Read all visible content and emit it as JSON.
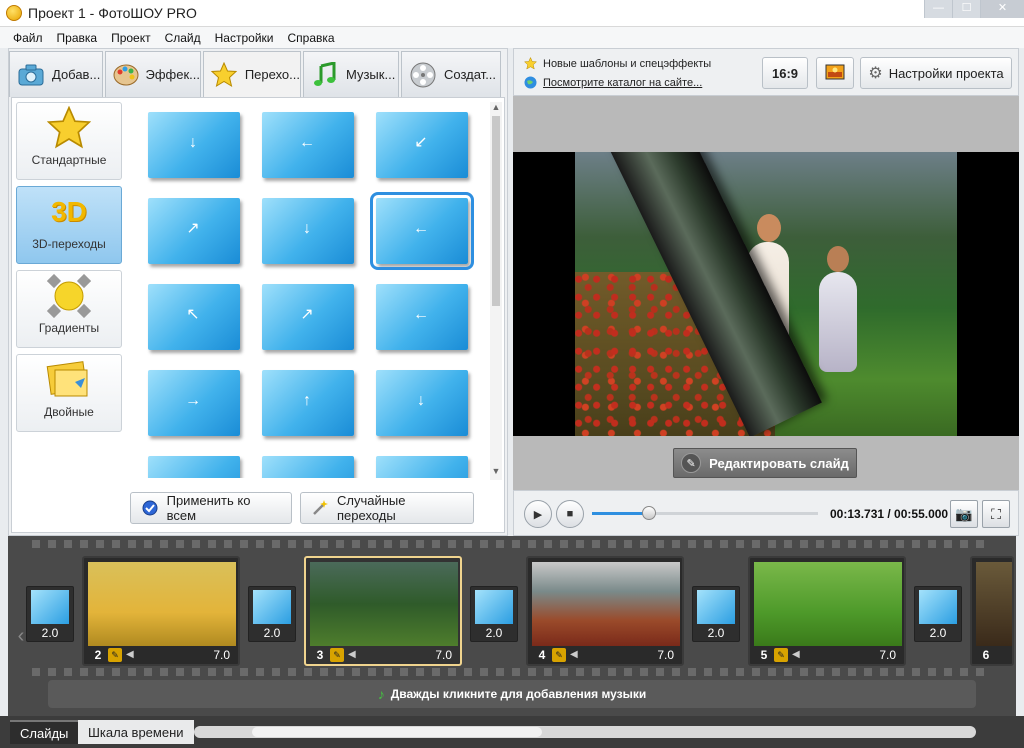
{
  "window": {
    "title": "Проект 1 - ФотоШОУ PRO",
    "min_btn": "—",
    "max_btn": "☐",
    "close_btn": "✕"
  },
  "menu": [
    "Файл",
    "Правка",
    "Проект",
    "Слайд",
    "Настройки",
    "Справка"
  ],
  "tabs": [
    {
      "label": "Добав...",
      "icon": "camera-icon"
    },
    {
      "label": "Эффек...",
      "icon": "palette-icon"
    },
    {
      "label": "Перехо...",
      "icon": "star-icon",
      "active": true
    },
    {
      "label": "Музык...",
      "icon": "music-note-icon"
    },
    {
      "label": "Создат...",
      "icon": "film-reel-icon"
    }
  ],
  "categories": [
    {
      "label": "Стандартные",
      "icon": "star-icon"
    },
    {
      "label": "3D-переходы",
      "icon": "3d-icon",
      "badge": "3D",
      "active": true
    },
    {
      "label": "Градиенты",
      "icon": "gradient-icon"
    },
    {
      "label": "Двойные",
      "icon": "double-icon"
    }
  ],
  "apply_all": "Применить ко всем",
  "random_transitions": "Случайные переходы",
  "notices": {
    "new_templates": "Новые шаблоны и спецэффекты",
    "catalog_link": "Посмотрите каталог на сайте..."
  },
  "aspect_ratio": "16:9",
  "project_settings": "Настройки проекта",
  "edit_slide": "Редактировать слайд",
  "playback": {
    "time": "00:13.731 / 00:55.000",
    "progress": 0.25
  },
  "storyboard": {
    "transitions": [
      "2.0",
      "2.0",
      "2.0",
      "2.0",
      "2.0"
    ],
    "slides": [
      {
        "num": "2",
        "duration": "7.0"
      },
      {
        "num": "3",
        "duration": "7.0",
        "selected": true
      },
      {
        "num": "4",
        "duration": "7.0"
      },
      {
        "num": "5",
        "duration": "7.0"
      },
      {
        "num": "6"
      }
    ],
    "music_hint": "Дважды кликните для добавления музыки"
  },
  "bottom_tabs": {
    "slides": "Слайды",
    "timeline": "Шкала времени"
  },
  "colors": {
    "accent": "#2e8fe0",
    "selected_slide": "#f0d48e"
  }
}
